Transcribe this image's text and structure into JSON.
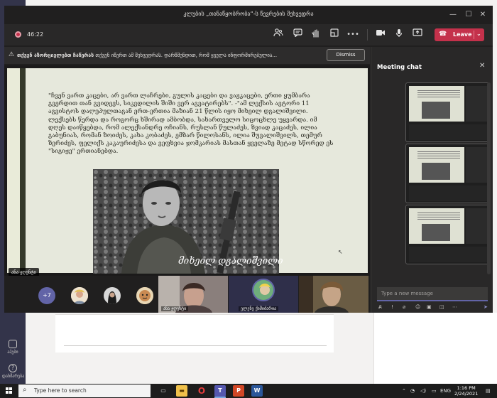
{
  "window": {
    "title": "კლუბის „თანაწყობრობა“-ს წევრების შეხვედრა",
    "controls": {
      "minimize": "—",
      "maximize": "☐",
      "close": "✕"
    }
  },
  "toolbar": {
    "timer": "46:22",
    "icons": [
      "people-icon",
      "chat-icon",
      "raise-hand-icon",
      "breakout-icon",
      "more-icon",
      "camera-icon",
      "mic-icon",
      "share-icon"
    ],
    "leave_label": "Leave"
  },
  "banner": {
    "prefix": "თქვენ აზორციელებთ ჩაწერას",
    "message": "თქვენ იწერთ ამ შეხვედრას. დარწმუნდით, რომ ყველა ინფორმირებულია...",
    "dismiss_label": "Dismiss"
  },
  "slide": {
    "paragraph": "\"ჩვენ ვართ კაცები, არ ვართ ლაჩრები, გულის კაცები და ვაჟკაცები, ერთი ყუმბარა გვერდით თან გვიდევს, სიკვდილის შიში ვერ აგვატირებს\". -\"ამ ლექსის ავტორი 11 აგვისტოს დაღუპულთაგან ერთ-ერთია მაზიან 21 წლის იყო მიხეილ დგალიშვილი. ლექსებს წერდა და როგორც ხშირად ამბობდა, სახართველო სიცოცხლე უყვარდა. იმ დღეს დაიწყებდა, რომ ალექსანდრე ოჩიანს, რუსლან წულაძეს, ზვიად კაცაძეს, ილია გაბუნიას, რომან ზოიძეს, კახა კობაძეს, ემზარ წილოსანს, ილია შუვალიშვილს, თემურ ზერიძეს, ფელიქს კაკაურიძესა და ვეფხვია ჯომკარიას მასთან ყველაზე მეტად სწორედ ეს \"სიგიჟე\" ერთიანებდა.",
    "signature": "მიხეილ დგალიშვილი",
    "presenter": "ანა ჟღენტი"
  },
  "participants": {
    "more_count": "+7",
    "tiles": [
      {
        "name": "ანა ჟღენტი"
      },
      {
        "name": "ელენე ქიმიძარია"
      }
    ]
  },
  "chat": {
    "title": "Meeting chat",
    "close": "✕",
    "compose_placeholder": "Type a new message",
    "tools": [
      "format-icon",
      "important-icon",
      "attach-icon",
      "emoji-icon",
      "gif-icon",
      "sticker-icon",
      "more-options-icon",
      "send-icon"
    ]
  },
  "taskbar": {
    "search_placeholder": "Type here to search",
    "time": "1:16 PM",
    "date": "2/24/2021",
    "lang": "ENG"
  },
  "colors": {
    "accent": "#6264a7",
    "leave": "#c4314b",
    "window_bg": "#201f1f",
    "slide_bg": "#e6e8dc"
  }
}
